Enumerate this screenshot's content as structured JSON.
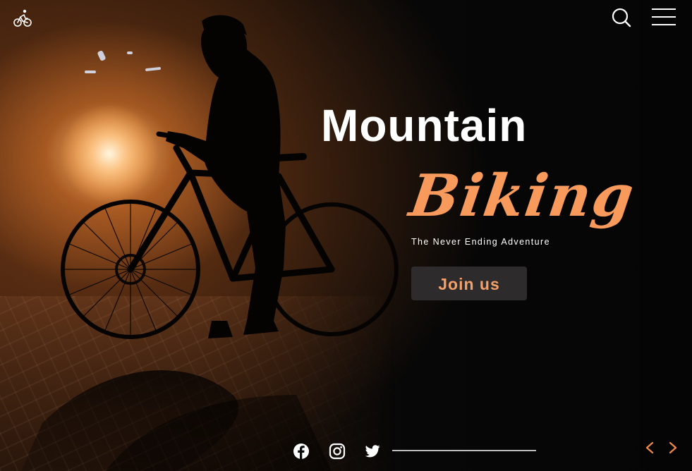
{
  "header": {
    "logo_icon": "bicycle-rider-icon",
    "search_icon": "search-icon",
    "menu_icon": "hamburger-menu-icon"
  },
  "hero": {
    "title_line1": "Mountain",
    "title_line2": "Biking",
    "tagline": "The Never Ending Adventure",
    "cta_label": "Join us"
  },
  "footer": {
    "social": [
      {
        "icon": "facebook-icon"
      },
      {
        "icon": "instagram-icon"
      },
      {
        "icon": "twitter-icon"
      }
    ],
    "prev_icon": "chevron-left-icon",
    "next_icon": "chevron-right-icon"
  },
  "colors": {
    "accent": "#f79a5c",
    "button_bg": "#2d2b2b",
    "text": "#ffffff",
    "arrow": "#f08a4b"
  }
}
